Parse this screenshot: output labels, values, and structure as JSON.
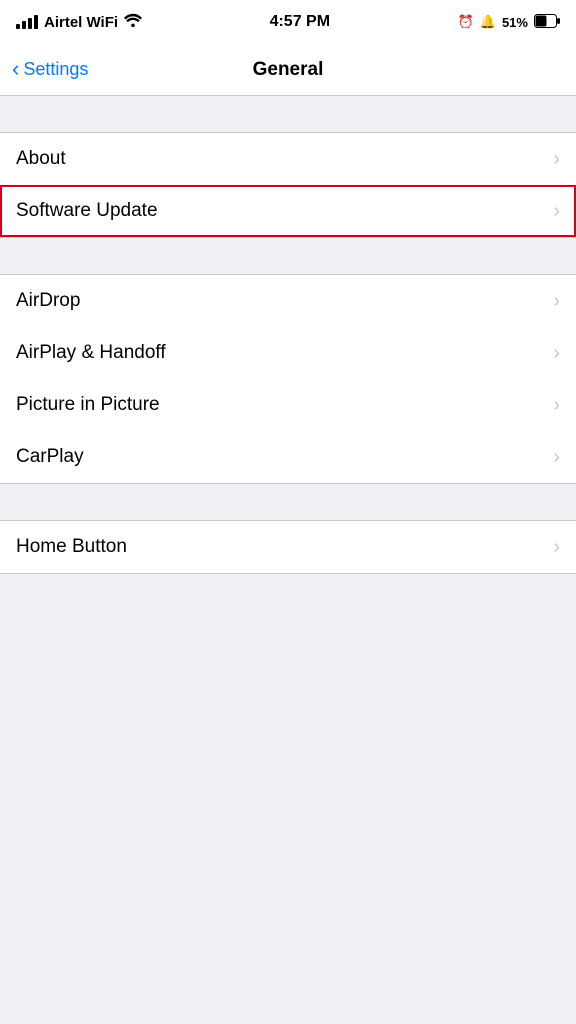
{
  "statusBar": {
    "carrier": "Airtel WiFi",
    "time": "4:57 PM",
    "alarm": "⏰",
    "battery": "51%"
  },
  "navBar": {
    "backLabel": "Settings",
    "title": "General"
  },
  "sections": [
    {
      "id": "group1",
      "items": [
        {
          "id": "about",
          "label": "About",
          "highlighted": false
        },
        {
          "id": "software-update",
          "label": "Software Update",
          "highlighted": true
        }
      ]
    },
    {
      "id": "group2",
      "items": [
        {
          "id": "airdrop",
          "label": "AirDrop",
          "highlighted": false
        },
        {
          "id": "airplay-handoff",
          "label": "AirPlay & Handoff",
          "highlighted": false
        },
        {
          "id": "picture-in-picture",
          "label": "Picture in Picture",
          "highlighted": false
        },
        {
          "id": "carplay",
          "label": "CarPlay",
          "highlighted": false
        }
      ]
    },
    {
      "id": "group3",
      "items": [
        {
          "id": "home-button",
          "label": "Home Button",
          "highlighted": false
        }
      ]
    }
  ],
  "icons": {
    "chevron": "›",
    "back": "‹"
  }
}
